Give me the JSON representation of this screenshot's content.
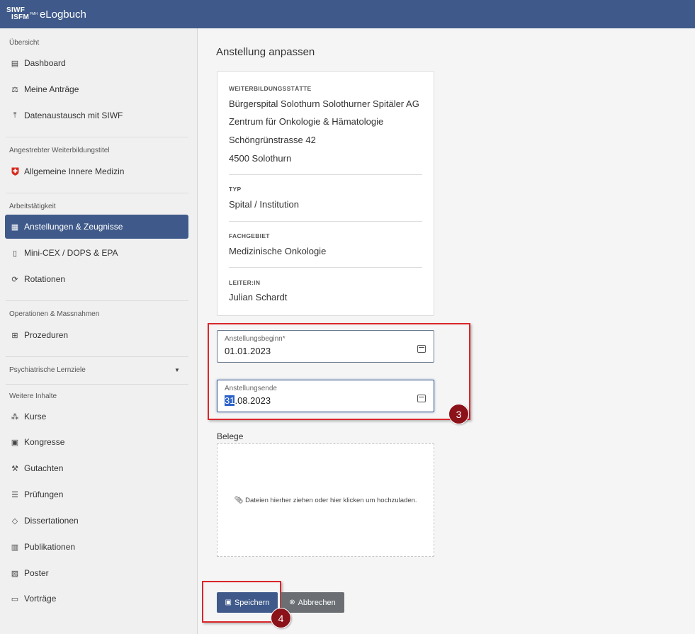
{
  "header": {
    "logo_line1": "SIWF",
    "logo_line2": "ISFM",
    "logo_fmh": "FMH",
    "app_name": "eLogbuch"
  },
  "sidebar": {
    "sections": {
      "overview": "Übersicht",
      "target_title": "Angestrebter Weiterbildungstitel",
      "work": "Arbeitstätigkeit",
      "operations": "Operationen & Massnahmen",
      "psych": "Psychiatrische Lernziele",
      "more": "Weitere Inhalte"
    },
    "items": {
      "dashboard": "Dashboard",
      "antraege": "Meine Anträge",
      "datenaustausch": "Datenaustausch mit SIWF",
      "innere_medizin": "Allgemeine Innere Medizin",
      "anstellungen": "Anstellungen & Zeugnisse",
      "minicex": "Mini-CEX / DOPS & EPA",
      "rotationen": "Rotationen",
      "prozeduren": "Prozeduren",
      "kurse": "Kurse",
      "kongresse": "Kongresse",
      "gutachten": "Gutachten",
      "pruefungen": "Prüfungen",
      "dissertationen": "Dissertationen",
      "publikationen": "Publikationen",
      "poster": "Poster",
      "vortraege": "Vorträge"
    }
  },
  "main": {
    "title": "Anstellung anpassen",
    "card": {
      "label_site": "WEITERBILDUNGSSTÄTTE",
      "site_line1": "Bürgerspital Solothurn Solothurner Spitäler AG",
      "site_line2": "Zentrum für Onkologie & Hämatologie",
      "site_line3": "Schöngrünstrasse 42",
      "site_line4": "4500 Solothurn",
      "label_type": "TYP",
      "type": "Spital / Institution",
      "label_field": "FACHGEBIET",
      "field": "Medizinische Onkologie",
      "label_head": "LEITER:IN",
      "head": "Julian Schardt"
    },
    "start": {
      "label": "Anstellungsbeginn*",
      "value": "01.01.2023"
    },
    "end": {
      "label": "Anstellungsende",
      "value_selected": "31",
      "value_rest": ".08.2023"
    },
    "belege_label": "Belege",
    "dropzone_text": "Dateien hierher ziehen oder hier klicken um hochzuladen.",
    "save_label": "Speichern",
    "cancel_label": "Abbrechen",
    "marker3": "3",
    "marker4": "4"
  },
  "colors": {
    "brand": "#3f5a8a",
    "annotation_red": "#d9262b",
    "marker": "#8a1218"
  }
}
